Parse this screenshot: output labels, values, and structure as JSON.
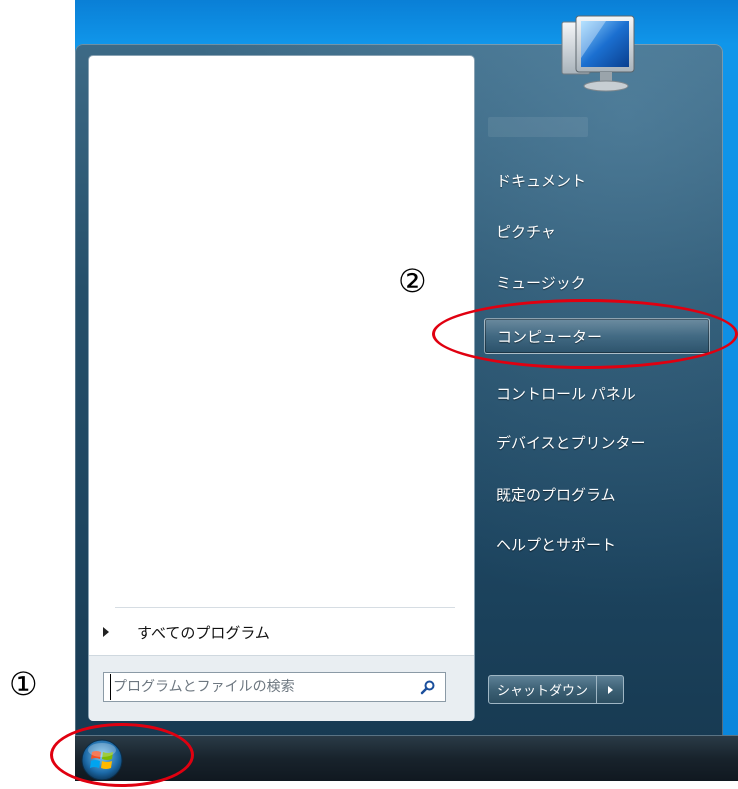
{
  "start_menu": {
    "right_items": [
      {
        "label": "ドキュメント"
      },
      {
        "label": "ピクチャ"
      },
      {
        "label": "ミュージック"
      },
      {
        "label": "コンピューター"
      },
      {
        "label": "コントロール パネル"
      },
      {
        "label": "デバイスとプリンター"
      },
      {
        "label": "既定のプログラム"
      },
      {
        "label": "ヘルプとサポート"
      }
    ],
    "all_programs_label": "すべてのプログラム",
    "search": {
      "placeholder": "プログラムとファイルの検索"
    },
    "shutdown_label": "シャットダウン",
    "highlighted_item": "コンピューター"
  },
  "annotations": {
    "step1": "①",
    "step2": "②"
  },
  "colors": {
    "annotation_red": "#e00010",
    "menu_blue": "#254f6a"
  },
  "icons": [
    "computer-icon",
    "search-icon",
    "windows-start-orb-icon",
    "shutdown-arrow-icon",
    "all-programs-arrow-icon"
  ]
}
